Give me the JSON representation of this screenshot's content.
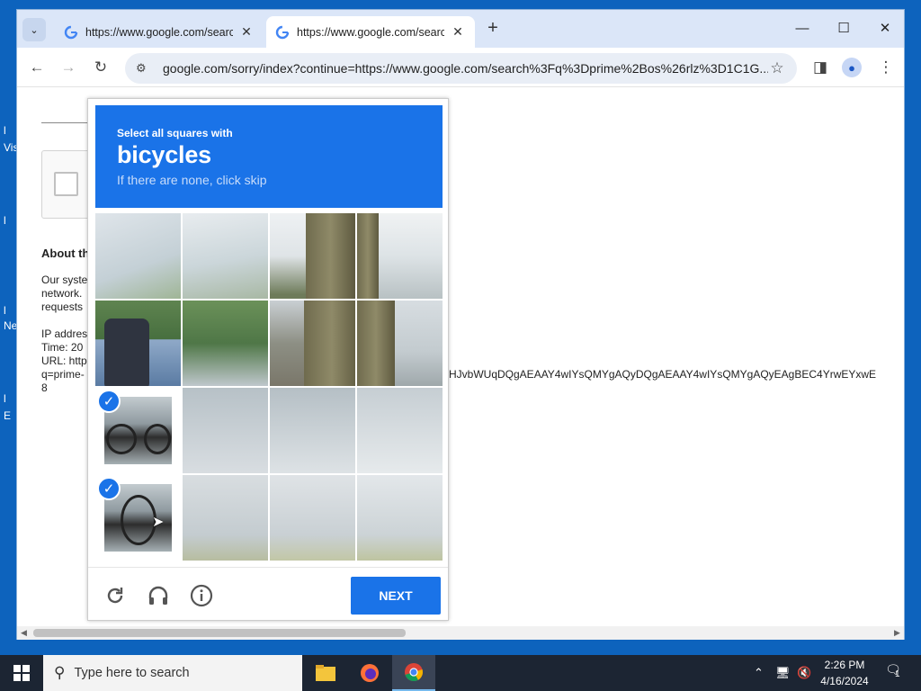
{
  "desktop": {
    "labels": [
      "l",
      "Vis",
      "l",
      "l",
      "Ne",
      "l",
      "E"
    ]
  },
  "browser": {
    "tabs": [
      {
        "title": "https://www.google.com/search",
        "active": false
      },
      {
        "title": "https://www.google.com/search",
        "active": true
      }
    ],
    "new_tab_label": "+",
    "address": "google.com/sorry/index?continue=https://www.google.com/search%3Fq%3Dprime%2Bos%26rlz%3D1C1G...",
    "window_controls": {
      "minimize": "—",
      "maximize": "☐",
      "close": "✕"
    }
  },
  "page": {
    "about_heading": "About th",
    "para1": [
      "Our syste",
      "network.",
      "requests"
    ],
    "para2": [
      "IP addres",
      "Time: 20",
      "URL: http",
      "q=prime-",
      "8"
    ],
    "long_url_tail": "HJvbWUqDQgAEAAY4wIYsQMYgAQyDQgAEAAY4wIYsQMYgAQyEAgBEC4YrwEYxwE"
  },
  "captcha": {
    "instruction_line1": "Select all squares with",
    "target": "bicycles",
    "instruction_line3": "If there are none, click skip",
    "selected_tiles": [
      8,
      12
    ],
    "next_label": "NEXT",
    "icons": [
      "reload-icon",
      "audio-icon",
      "info-icon"
    ]
  },
  "taskbar": {
    "search_placeholder": "Type here to search",
    "time": "2:26 PM",
    "date": "4/16/2024",
    "notification_count": "1"
  },
  "colors": {
    "accent": "#1a73e8",
    "desktop": "#0d63bd",
    "taskbar": "#1c2533"
  }
}
